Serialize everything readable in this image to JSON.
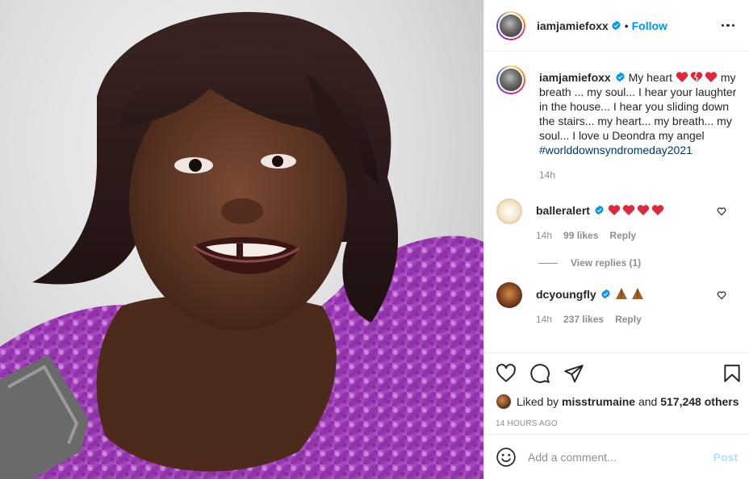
{
  "photo": {
    "alt_subject": "portrait-photo"
  },
  "header": {
    "username": "iamjamiefoxx",
    "separator": "•",
    "follow_label": "Follow",
    "more_icon": "more-horizontal-icon"
  },
  "caption": {
    "username": "iamjamiefoxx",
    "text": "My heart ❤️💔❤️ my breath ... my soul... I hear your laughter in the house... I hear you sliding down the stairs... my heart... my breath... my soul... I love u Deondra my angel",
    "lead": "My heart",
    "body": "my breath ... my soul... I hear your laughter in the house... I hear you sliding down the stairs... my heart... my breath... my soul... I love u Deondra my angel",
    "hashtag": "#worlddownsyndromeday2021",
    "age": "14h"
  },
  "comments": [
    {
      "username": "balleralert",
      "text": "❤️❤️❤️❤️",
      "age": "14h",
      "likes": "99 likes",
      "reply_label": "Reply",
      "view_replies": "View replies (1)"
    },
    {
      "username": "dcyoungfly",
      "text": "🙏🏾🙏🏾",
      "age": "14h",
      "likes": "237 likes",
      "reply_label": "Reply"
    }
  ],
  "likes": {
    "prefix": "Liked by",
    "user": "misstrumaine",
    "joiner": "and",
    "others": "517,248 others"
  },
  "timestamp": "14 HOURS AGO",
  "add_comment": {
    "placeholder": "Add a comment...",
    "post_label": "Post"
  },
  "colors": {
    "link_blue": "#0095f6",
    "hashtag": "#00376b",
    "heart_red": "#ed4956",
    "muted": "#8e8e8e"
  }
}
